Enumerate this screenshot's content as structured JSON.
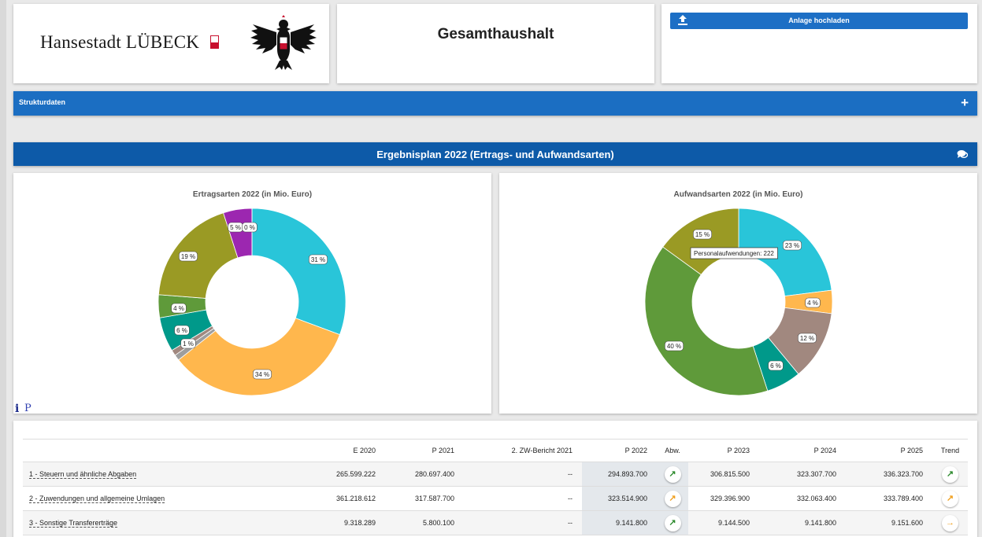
{
  "header": {
    "logo_text": "Hansestadt LÜBECK",
    "title": "Gesamthaushalt",
    "upload_label": "Anlage hochladen"
  },
  "strukturdaten": {
    "label": "Strukturdaten",
    "toggle": "+"
  },
  "section": {
    "title": "Ergebnisplan 2022 (Ertrags- und Aufwandsarten)"
  },
  "chart_data": [
    {
      "type": "pie",
      "title": "Ertragsarten 2022 (in Mio. Euro)",
      "slices": [
        {
          "label": "31 %",
          "value": 31,
          "color": "#29c5d9"
        },
        {
          "label": "34 %",
          "value": 34,
          "color": "#ffb74d"
        },
        {
          "label": "",
          "value": 1,
          "color": "#9e9e9e"
        },
        {
          "label": "1 %",
          "value": 1,
          "color": "#a1887f"
        },
        {
          "label": "6 %",
          "value": 6,
          "color": "#00998a"
        },
        {
          "label": "4 %",
          "value": 4,
          "color": "#5f9a3a"
        },
        {
          "label": "19 %",
          "value": 19,
          "color": "#9a9a24"
        },
        {
          "label": "5 %",
          "value": 5,
          "color": "#9c27b0"
        },
        {
          "label": "0 %",
          "value": 0,
          "color": "#d9d9d9"
        }
      ]
    },
    {
      "type": "pie",
      "title": "Aufwandsarten 2022 (in Mio. Euro)",
      "tooltip": "Personalaufwendungen: 222",
      "slices": [
        {
          "label": "23 %",
          "value": 23,
          "color": "#29c5d9"
        },
        {
          "label": "4 %",
          "value": 4,
          "color": "#ffb74d"
        },
        {
          "label": "12 %",
          "value": 12,
          "color": "#a1887f"
        },
        {
          "label": "6 %",
          "value": 6,
          "color": "#00998a"
        },
        {
          "label": "40 %",
          "value": 40,
          "color": "#5f9a3a"
        },
        {
          "label": "15 %",
          "value": 15,
          "color": "#9a9a24"
        }
      ]
    }
  ],
  "table": {
    "headers": [
      "",
      "E 2020",
      "P 2021",
      "2. ZW-Bericht 2021",
      "P 2022",
      "Abw.",
      "P 2023",
      "P 2024",
      "P 2025",
      "Trend"
    ],
    "rows": [
      {
        "name": "1 - Steuern und ähnliche Abgaben",
        "e2020": "265.599.222",
        "p2021": "280.697.400",
        "zw2021": "--",
        "p2022": "294.893.700",
        "abw": "↗",
        "abw_color": "#2e8b2e",
        "p2023": "306.815.500",
        "p2024": "323.307.700",
        "p2025": "336.323.700",
        "trend": "↗",
        "trend_color": "#2e8b2e"
      },
      {
        "name": "2 - Zuwendungen und allgemeine Umlagen",
        "e2020": "361.218.612",
        "p2021": "317.587.700",
        "zw2021": "--",
        "p2022": "323.514.900",
        "abw": "↗",
        "abw_color": "#f0a020",
        "p2023": "329.396.900",
        "p2024": "332.063.400",
        "p2025": "333.789.400",
        "trend": "↗",
        "trend_color": "#f0a020"
      },
      {
        "name": "3 - Sonstige Transfererträge",
        "e2020": "9.318.289",
        "p2021": "5.800.100",
        "zw2021": "--",
        "p2022": "9.141.800",
        "abw": "↗",
        "abw_color": "#2e8b2e",
        "p2023": "9.144.500",
        "p2024": "9.141.800",
        "p2025": "9.151.600",
        "trend": "→",
        "trend_color": "#f0a020"
      }
    ]
  },
  "icons": {
    "upload": "upload-icon",
    "comment": "comment-icon",
    "info": "i",
    "p": "P"
  }
}
